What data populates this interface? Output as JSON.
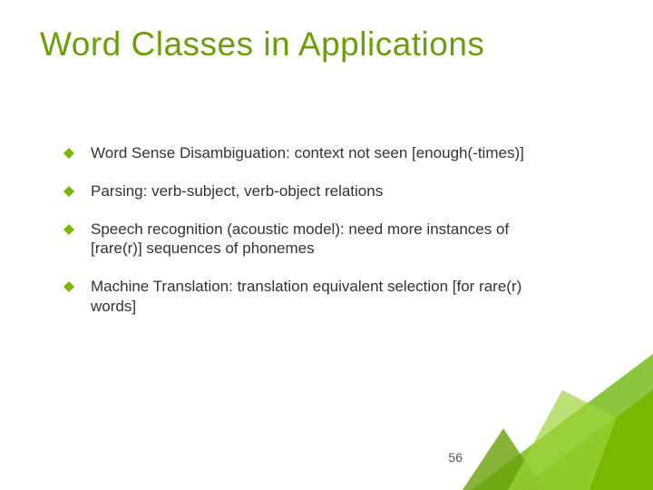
{
  "title": "Word Classes in Applications",
  "bullets": [
    "Word Sense Disambiguation: context not seen [enough(-times)]",
    "Parsing: verb-subject, verb-object relations",
    "Speech recognition (acoustic model): need more instances of [rare(r)] sequences of phonemes",
    "Machine Translation: translation equivalent selection [for rare(r) words]"
  ],
  "slide_number": "56",
  "colors": {
    "accent": "#76b900",
    "title": "#6aa007"
  }
}
